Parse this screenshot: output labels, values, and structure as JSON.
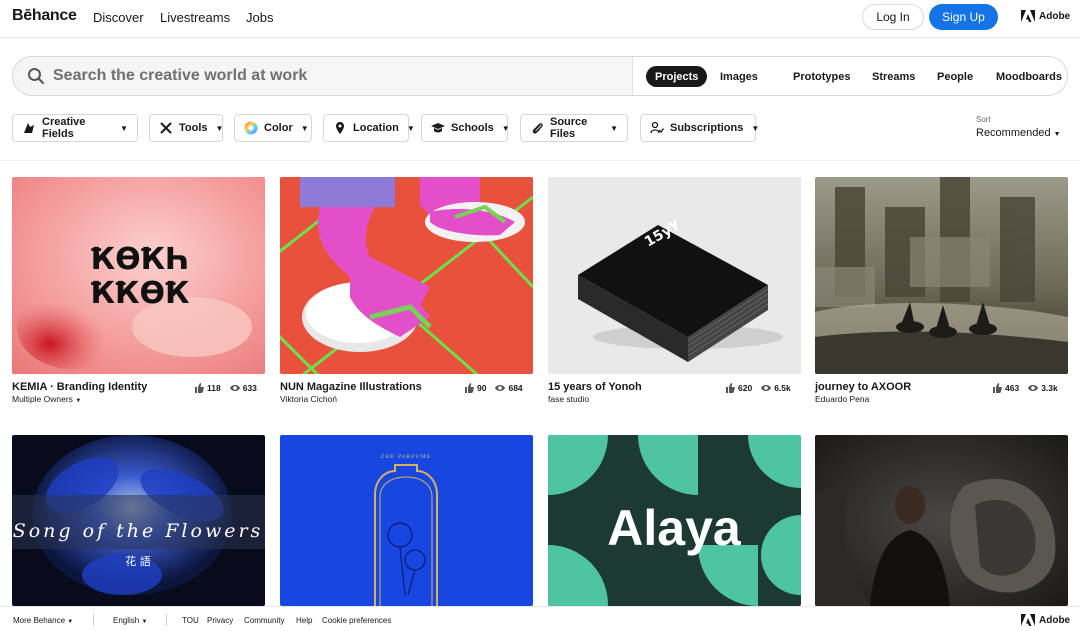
{
  "brand": "Bēhance",
  "nav": {
    "discover": "Discover",
    "livestreams": "Livestreams",
    "jobs": "Jobs",
    "login": "Log In",
    "signup": "Sign Up",
    "adobe": "Adobe"
  },
  "search": {
    "placeholder": "Search the creative world at work",
    "tabs": [
      "Projects",
      "Images",
      "Prototypes",
      "Streams",
      "People",
      "Moodboards"
    ]
  },
  "filters": [
    "Creative Fields",
    "Tools",
    "Color",
    "Location",
    "Schools",
    "Source Files",
    "Subscriptions"
  ],
  "sort": {
    "label": "Sort",
    "value": "Recommended"
  },
  "projects": [
    {
      "title": "KEMIA · Branding Identity",
      "owner": "Multiple Owners",
      "likes": "118",
      "views": "633"
    },
    {
      "title": "NUN Magazine Illustrations",
      "owner": "Viktoria Cichoń",
      "likes": "90",
      "views": "684"
    },
    {
      "title": "15 years of Yonoh",
      "owner": "fase studio",
      "likes": "620",
      "views": "6.5k"
    },
    {
      "title": "journey to AXOOR",
      "owner": "Eduardo Pena",
      "likes": "463",
      "views": "3.3k"
    }
  ],
  "images": {
    "kemia_line1": "ҞӨҞҺ",
    "kemia_line2": "ҞҞӨҞ",
    "yonoh_cover": "15yY",
    "flowers_text": "Song of the Flowers",
    "flowers_cn": "花 語",
    "parfume_text": "ZHE PARFUMÉ",
    "alaya_text": "Alaya"
  },
  "footer": {
    "more": "More Behance",
    "lang": "English",
    "links": [
      "TOU",
      "Privacy",
      "Community",
      "Help",
      "Cookie preferences"
    ],
    "adobe": "Adobe"
  },
  "colors": {
    "accent": "#1473e6",
    "text": "#191919"
  }
}
